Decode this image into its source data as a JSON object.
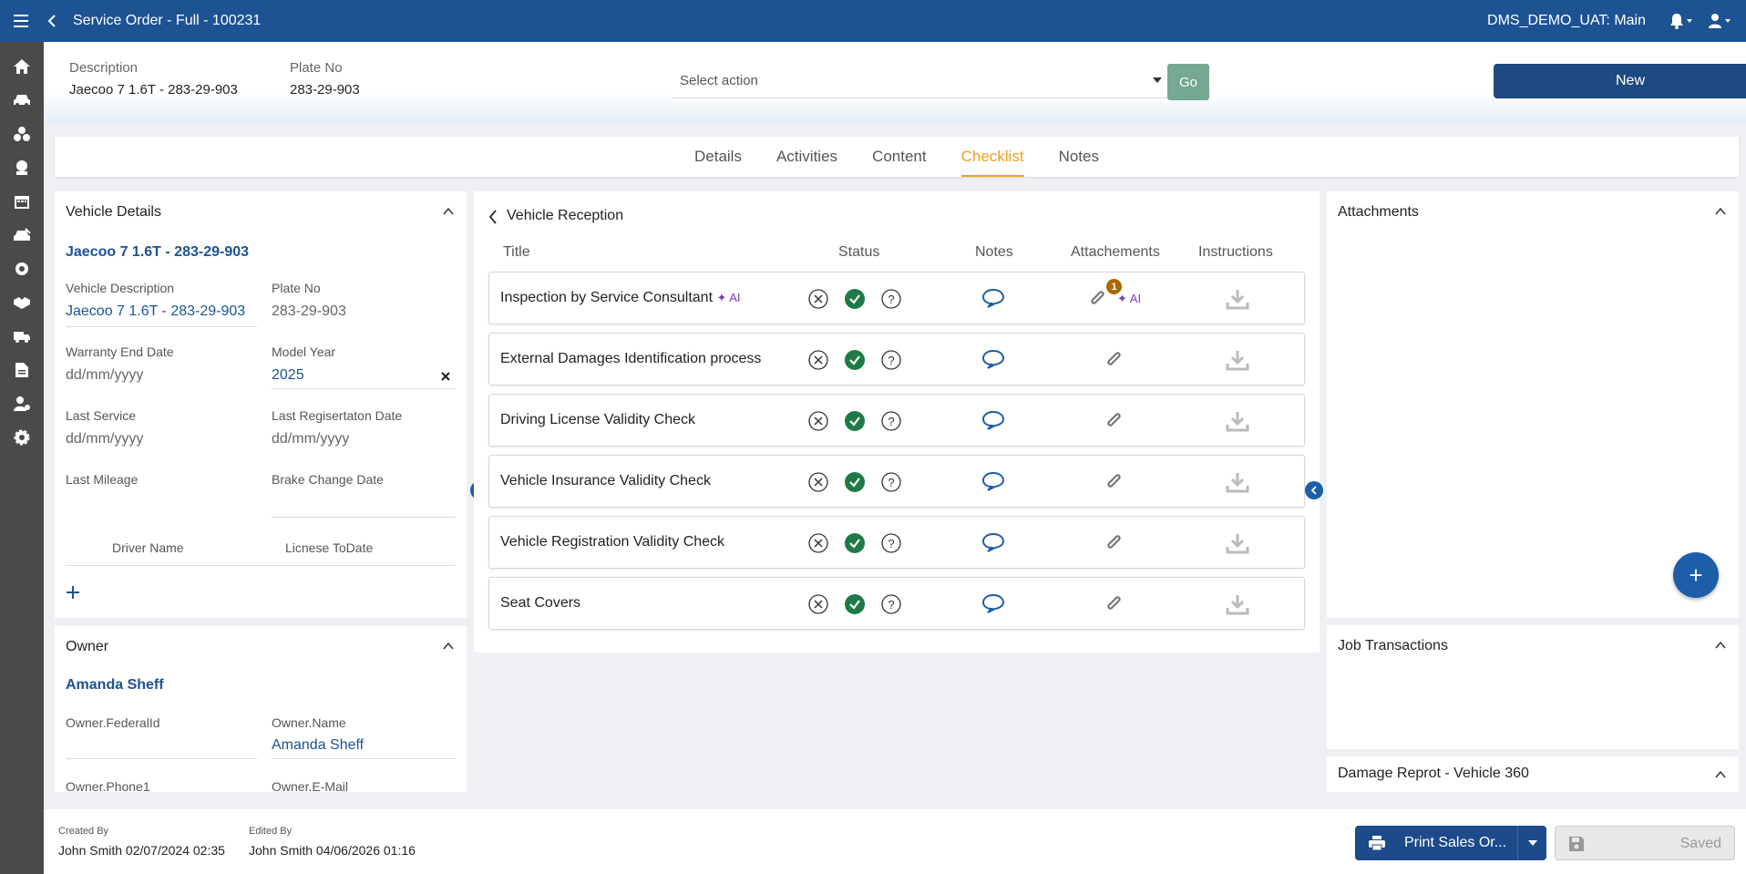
{
  "topbar": {
    "title": "Service Order - Full - 100231",
    "env": "DMS_DEMO_UAT: Main"
  },
  "header": {
    "description_label": "Description",
    "description_value": "Jaecoo 7 1.6T - 283-29-903",
    "plate_label": "Plate No",
    "plate_value": "283-29-903",
    "select_action_placeholder": "Select action",
    "go_label": "Go",
    "new_label": "New"
  },
  "tabs": [
    "Details",
    "Activities",
    "Content",
    "Checklist",
    "Notes"
  ],
  "vehicle": {
    "title": "Vehicle Details",
    "link": "Jaecoo 7 1.6T - 283-29-903",
    "desc_label": "Vehicle Description",
    "desc_value": "Jaecoo 7 1.6T - 283-29-903",
    "plate_label": "Plate No",
    "plate_value": "283-29-903",
    "warranty_label": "Warranty End Date",
    "warranty_value": "dd/mm/yyyy",
    "model_year_label": "Model Year",
    "model_year_value": "2025",
    "last_service_label": "Last Service",
    "last_service_value": "dd/mm/yyyy",
    "last_reg_label": "Last Regisertaton Date",
    "last_reg_value": "dd/mm/yyyy",
    "last_mileage_label": "Last Mileage",
    "brake_label": "Brake Change Date",
    "driver_name_label": "Driver Name",
    "license_label": "Licnese ToDate"
  },
  "owner": {
    "title": "Owner",
    "link": "Amanda Sheff",
    "federal_label": "Owner.FederalId",
    "name_label": "Owner.Name",
    "name_value": "Amanda Sheff",
    "phone_label": "Owner.Phone1",
    "email_label": "Owner.E-Mail"
  },
  "checklist": {
    "section_title": "Vehicle Reception",
    "columns": {
      "title": "Title",
      "status": "Status",
      "notes": "Notes",
      "attachments": "Attachements",
      "instructions": "Instructions"
    },
    "ai_label": "AI",
    "attachment_badge": "1",
    "rows": [
      {
        "title": "Inspection by Service Consultant"
      },
      {
        "title": "External Damages Identification process"
      },
      {
        "title": "Driving License Validity Check"
      },
      {
        "title": "Vehicle Insurance Validity Check"
      },
      {
        "title": "Vehicle Registration Validity Check"
      },
      {
        "title": "Seat Covers"
      }
    ]
  },
  "right_panels": {
    "attachments": "Attachments",
    "job_transactions": "Job Transactions",
    "damage_report": "Damage Reprot - Vehicle 360",
    "add_label": "+"
  },
  "footer": {
    "created_label": "Created By",
    "created_value": "John Smith 02/07/2024 02:35",
    "edited_label": "Edited By",
    "edited_value": "John Smith 04/06/2026 01:16",
    "print_label": "Print Sales Or...",
    "saved_label": "Saved"
  },
  "colors": {
    "primary": "#1d5293",
    "accent": "#f0a020",
    "status_ok": "#1e7a46",
    "ai": "#7d3db8"
  }
}
